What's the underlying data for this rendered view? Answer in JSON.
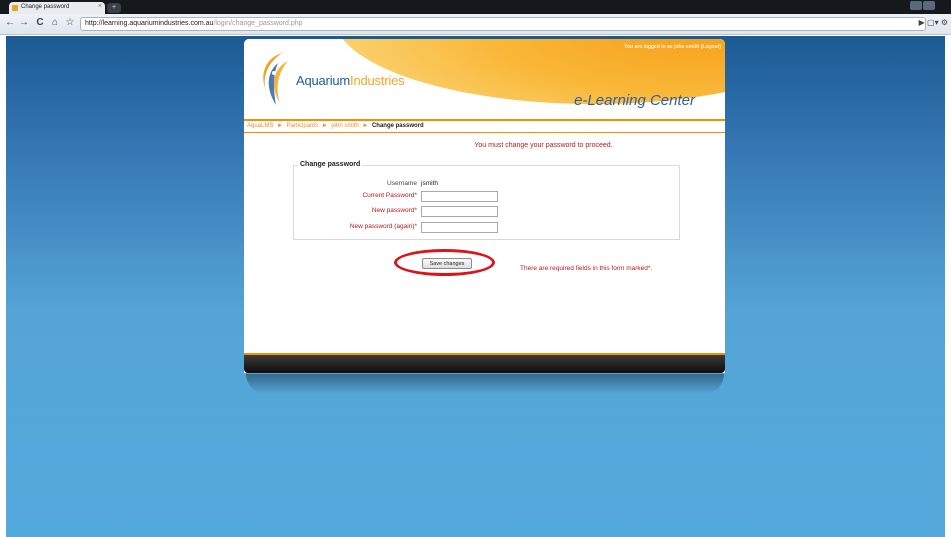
{
  "browser": {
    "tab_title": "Change password",
    "new_tab": "+",
    "nav": {
      "back": "←",
      "forward": "→",
      "reload": "C",
      "home": "⌂",
      "star": "☆"
    },
    "url_host": "http://learning.aquariumindustries.com.au",
    "url_path": "/login/change_password.php",
    "menu_icons": "▶ ▢▾ ⚙"
  },
  "header": {
    "logged_in_text": "You are logged in as john smith (Logout)",
    "brand_part1": "Aquarium",
    "brand_part2": "Industries",
    "subtitle": "e-Learning Center"
  },
  "breadcrumb": {
    "items": [
      "AquaLMS",
      "Participants",
      "john smith"
    ],
    "separator": "►",
    "current": "Change password"
  },
  "notice": "You must change your password to proceed.",
  "form": {
    "legend": "Change password",
    "username_label": "Username",
    "username_value": "jsmith",
    "current_password_label": "Current Password*",
    "new_password_label": "New password*",
    "new_password_again_label": "New password (again)*",
    "current_password_value": "",
    "new_password_value": "",
    "new_password_again_value": "",
    "save_label": "Save changes",
    "required_note": "There are required fields in this form marked*."
  },
  "colors": {
    "accent_orange": "#f29200",
    "error_red": "#b41b1b",
    "brand_blue": "#2c5ea4",
    "highlight_ring": "#d9141a"
  }
}
